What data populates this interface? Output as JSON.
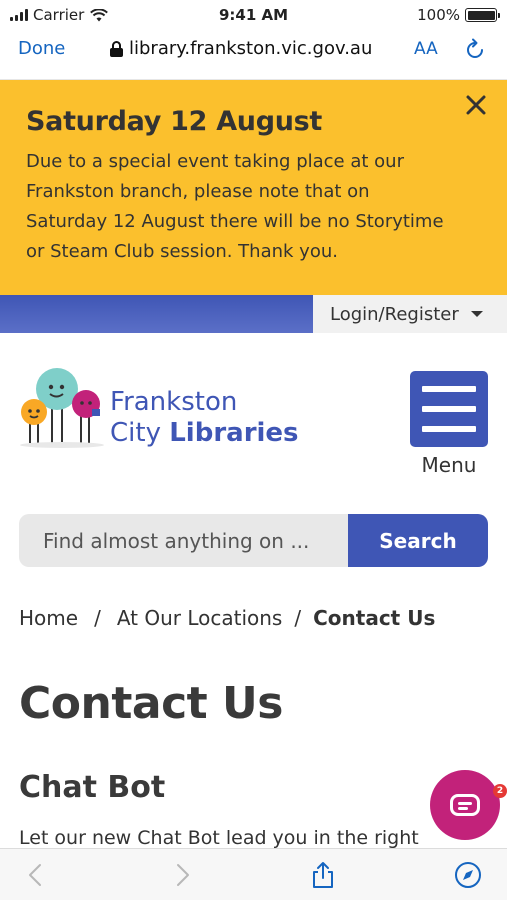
{
  "status_bar": {
    "carrier": "Carrier",
    "time": "9:41 AM",
    "battery": "100%"
  },
  "browser": {
    "done_label": "Done",
    "url": "library.frankston.vic.gov.au",
    "text_size_label": "AA"
  },
  "alert": {
    "title": "Saturday 12 August",
    "lines": [
      "Due to a special event taking place at our",
      "Frankston branch, please note that on",
      "Saturday 12 August there will be no Storytime",
      "or Steam Club session. Thank you."
    ]
  },
  "utility": {
    "login_label": "Login/Register"
  },
  "logo": {
    "line1": "Frankston",
    "line2_a": "City ",
    "line2_b": "Libraries"
  },
  "menu": {
    "label": "Menu"
  },
  "search": {
    "placeholder": "Find almost anything on ...",
    "button_label": "Search"
  },
  "breadcrumb": {
    "items": [
      "Home",
      "At Our Locations",
      "Contact Us"
    ],
    "separator": "/"
  },
  "content": {
    "title": "Contact Us",
    "subtitle": "Chat Bot",
    "body": "Let our new Chat Bot lead you in the right"
  },
  "chat": {
    "badge": "2"
  },
  "colors": {
    "brand_blue": "#3f56b5",
    "alert_yellow": "#fbc02d",
    "chat_magenta": "#c2227a"
  }
}
